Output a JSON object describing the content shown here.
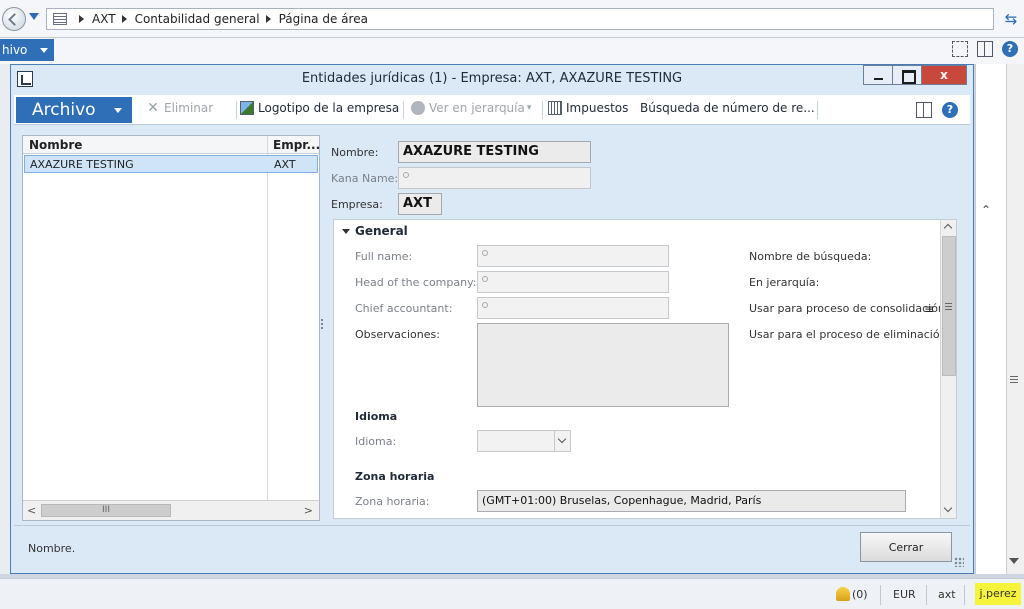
{
  "address_bar": {
    "breadcrumbs": [
      "AXT",
      "Contabilidad general",
      "Página de área"
    ]
  },
  "app_menu": {
    "archivo_label": "hivo"
  },
  "dialog": {
    "title": "Entidades jurídicas (1) - Empresa: AXT, AXAZURE TESTING",
    "close_glyph": "x",
    "ribbon": {
      "archivo": "Archivo",
      "eliminar": "Eliminar",
      "logotipo": "Logotipo de la empresa",
      "ver_jerarquia": "Ver en jerarquía",
      "impuestos": "Impuestos",
      "busqueda": "Búsqueda de número de re..."
    },
    "grid": {
      "columns": [
        "Nombre",
        "Empr..."
      ],
      "rows": [
        {
          "nombre": "AXAZURE TESTING",
          "empresa": "AXT"
        }
      ],
      "scroll_thumb": "III"
    },
    "header_fields": {
      "nombre_label": "Nombre:",
      "nombre_value": "AXAZURE TESTING",
      "kana_label": "Kana Name:",
      "empresa_label": "Empresa:",
      "empresa_value": "AXT"
    },
    "general": {
      "section": "General",
      "full_name": "Full name:",
      "head": "Head of the company:",
      "chief": "Chief accountant:",
      "observaciones": "Observaciones:",
      "nombre_busqueda": "Nombre de búsqueda:",
      "en_jerarquia": "En jerarquía:",
      "consolidacion": "Usar para proceso de consolidación fin",
      "eliminacion": "Usar para el proceso de eliminación fin",
      "idioma_section": "Idioma",
      "idioma_label": "Idioma:",
      "zona_section": "Zona horaria",
      "zona_label": "Zona horaria:",
      "zona_value": "(GMT+01:00) Bruselas, Copenhague, Madrid, París"
    },
    "footer": {
      "status_text": "Nombre.",
      "close_label": "Cerrar"
    }
  },
  "status_bar": {
    "notifications": "(0)",
    "currency": "EUR",
    "company": "axt",
    "user": "j.perez"
  },
  "colors": {
    "accent": "#2f6fb8",
    "dialog_bg": "#dbe8f5",
    "close_red": "#c8483b",
    "user_highlight": "#f6f43a"
  }
}
